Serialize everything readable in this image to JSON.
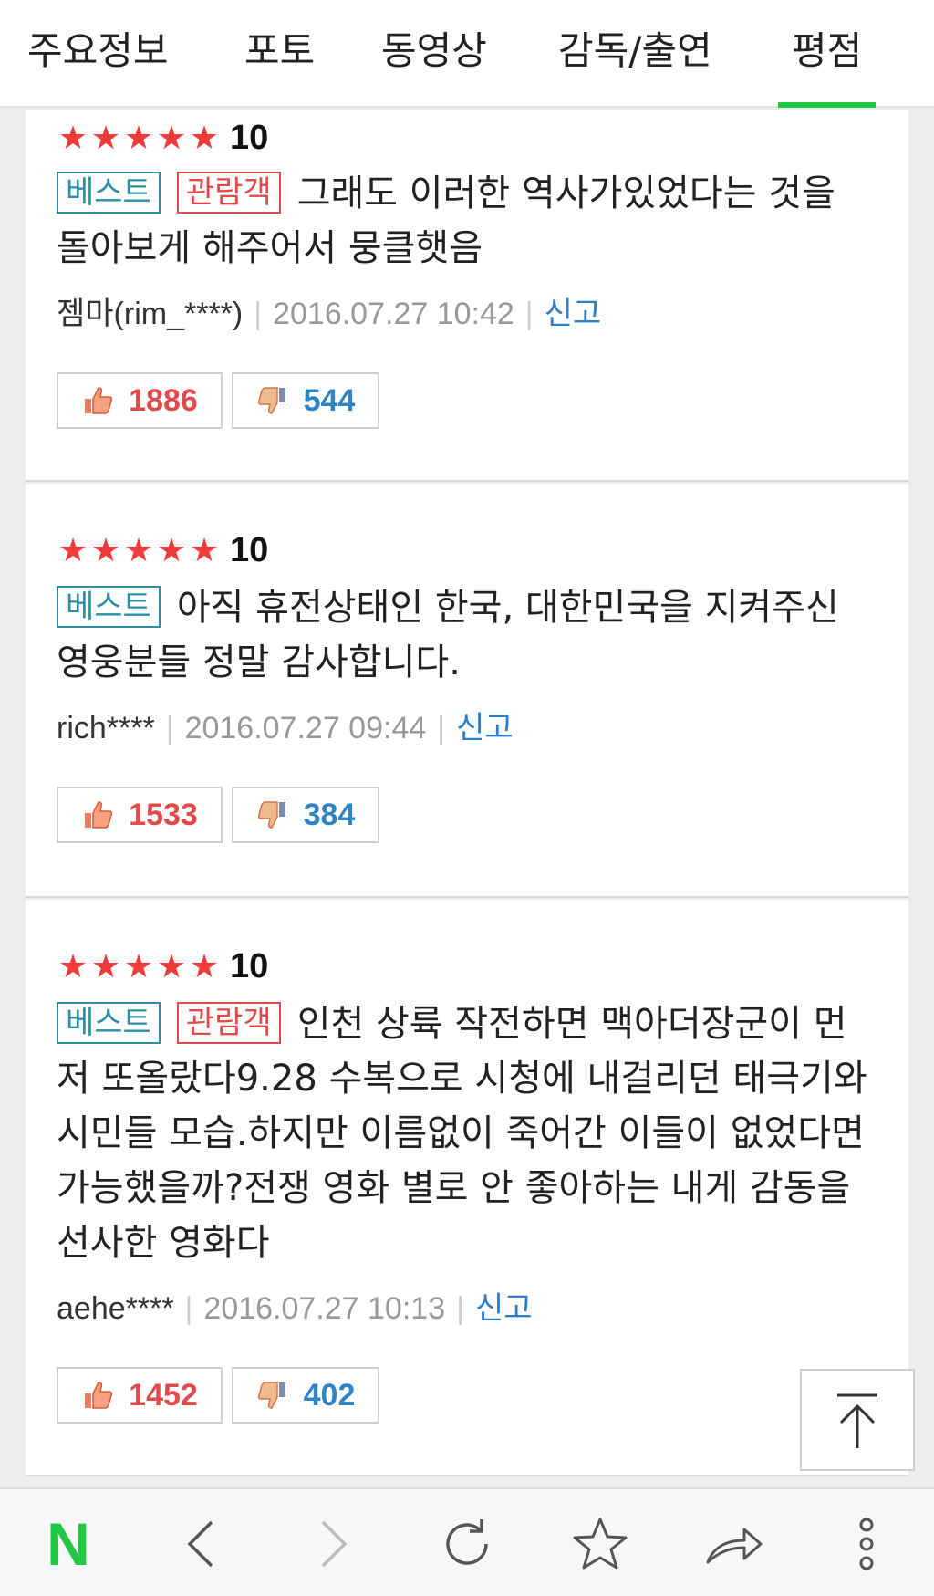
{
  "tabs": [
    {
      "label": "주요정보"
    },
    {
      "label": "포토"
    },
    {
      "label": "동영상"
    },
    {
      "label": "감독/출연"
    },
    {
      "label": "평점",
      "active": true
    }
  ],
  "reviews": [
    {
      "score": "10",
      "stars": 5,
      "badges": {
        "best": "베스트",
        "audience": "관람객"
      },
      "text": "그래도 이러한 역사가있었다는 것을 돌아보게 해주어서 뭉클햇음",
      "author": "젬마(rim_****)",
      "date": "2016.07.27 10:42",
      "report": "신고",
      "likes": "1886",
      "dislikes": "544"
    },
    {
      "score": "10",
      "stars": 5,
      "badges": {
        "best": "베스트"
      },
      "text": "아직 휴전상태인 한국, 대한민국을 지켜주신 영웅분들 정말 감사합니다.",
      "author": "rich****",
      "date": "2016.07.27 09:44",
      "report": "신고",
      "likes": "1533",
      "dislikes": "384"
    },
    {
      "score": "10",
      "stars": 5,
      "badges": {
        "best": "베스트",
        "audience": "관람객"
      },
      "text": "인천 상륙 작전하면 맥아더장군이 먼저 또올랐다9.28 수복으로 시청에 내걸리던 태극기와 시민들 모습.하지만 이름없이 죽어간 이들이 없었다면 가능했을까?전쟁 영화 별로 안 좋아하는 내게 감동을 선사한 영화다",
      "author": "aehe****",
      "date": "2016.07.27 10:13",
      "report": "신고",
      "likes": "1452",
      "dislikes": "402"
    }
  ],
  "browser_bar": {
    "logo": "N",
    "icons": [
      "naver-logo-icon",
      "back-icon",
      "forward-icon",
      "refresh-icon",
      "bookmark-star-icon",
      "share-icon",
      "more-icon"
    ]
  },
  "colors": {
    "accent": "#1fc742",
    "star": "#f03b3b",
    "best": "#2e8fa8",
    "audience": "#e04a4a",
    "link": "#2f7ec7"
  }
}
